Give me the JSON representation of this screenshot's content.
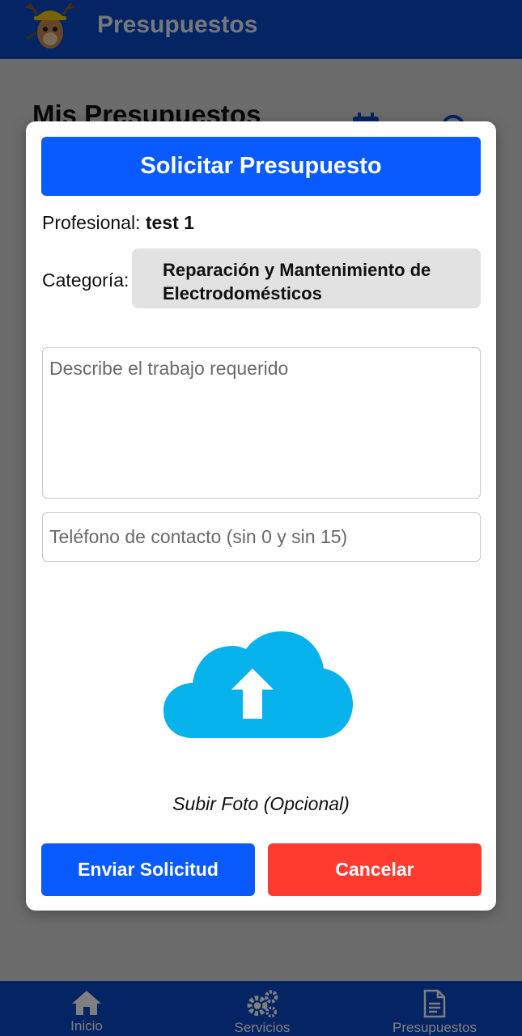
{
  "app": {
    "title": "Presupuestos",
    "page_heading": "Mis Presupuestos"
  },
  "bottom_nav": [
    {
      "label": "Inicio",
      "icon": "home-icon"
    },
    {
      "label": "Servicios",
      "icon": "gears-icon"
    },
    {
      "label": "Presupuestos",
      "icon": "document-icon"
    }
  ],
  "modal": {
    "title": "Solicitar Presupuesto",
    "professional_label": "Profesional:",
    "professional_name": "test 1",
    "category_label": "Categoría:",
    "category_value": "Reparación y Mantenimiento de Electrodomésticos",
    "description_placeholder": "Describe el trabajo requerido",
    "phone_placeholder": "Teléfono de contacto (sin 0 y sin 15)",
    "upload_label": "Subir Foto (Opcional)",
    "upload_icon": "cloud-upload-icon",
    "send_label": "Enviar Solicitud",
    "cancel_label": "Cancelar"
  },
  "colors": {
    "app_bar": "#0a49c9",
    "primary_button": "#0a5bff",
    "cancel_button": "#ff3b30",
    "upload_cloud": "#05b2ec"
  }
}
